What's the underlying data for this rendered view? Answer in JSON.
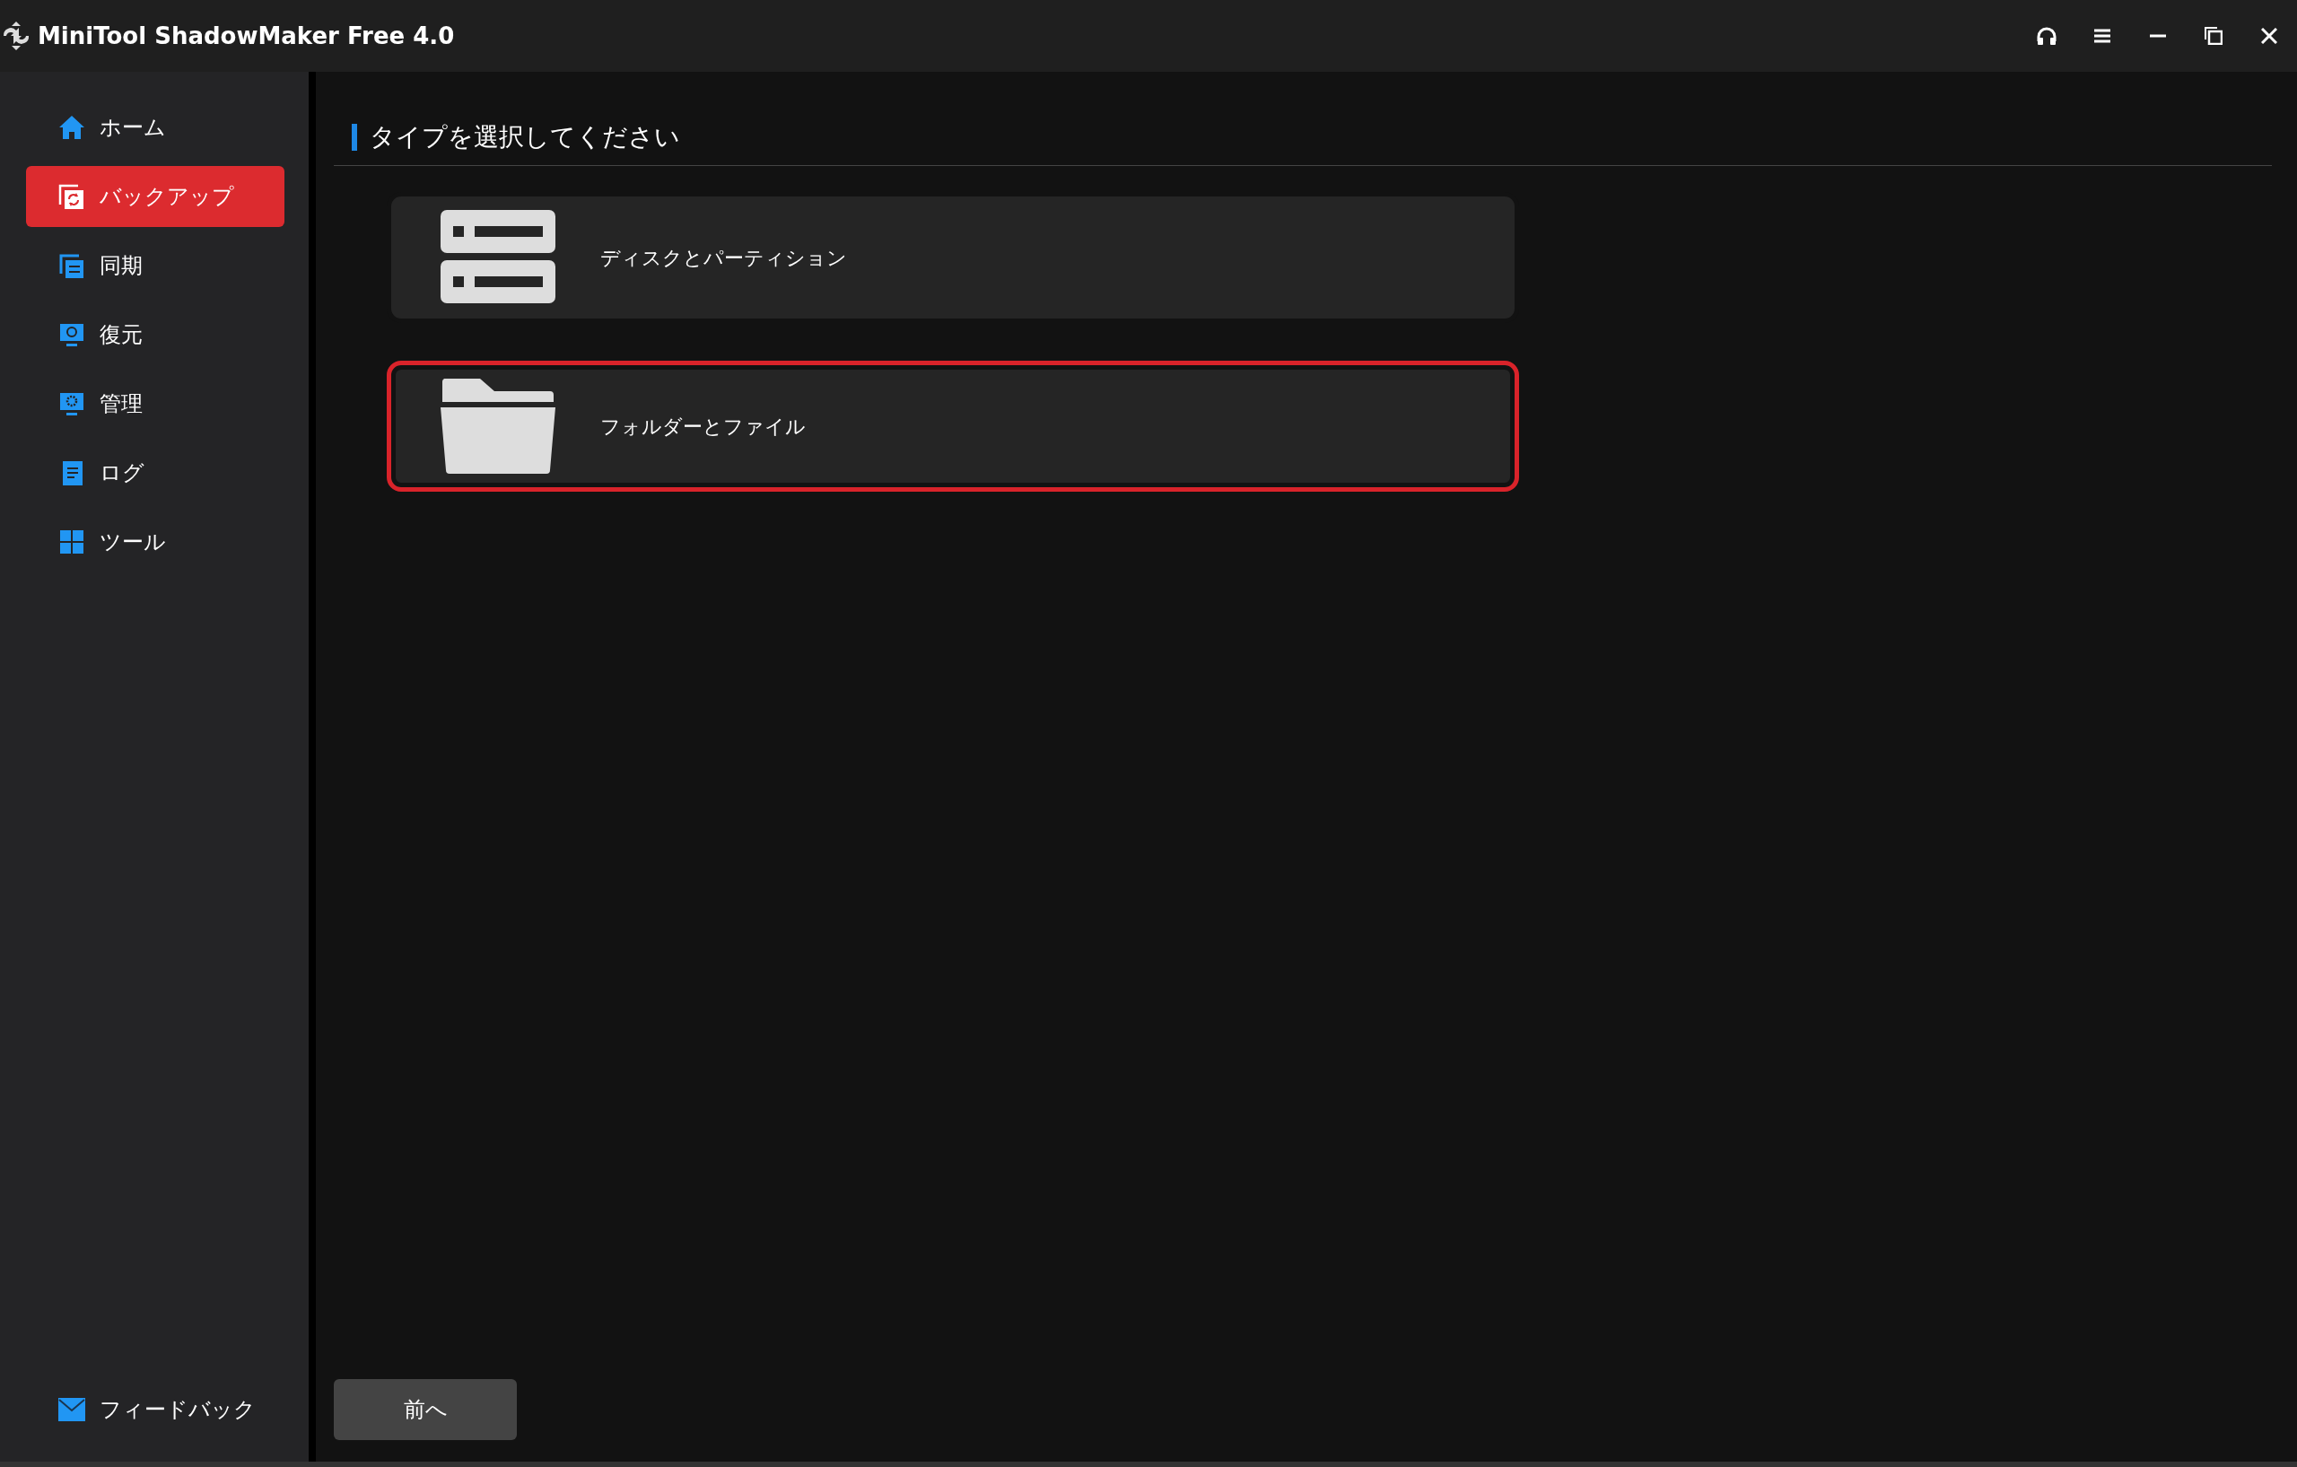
{
  "window": {
    "title": "MiniTool ShadowMaker Free 4.0"
  },
  "sidebar": {
    "items": [
      {
        "label": "ホーム",
        "selected": false
      },
      {
        "label": "バックアップ",
        "selected": true
      },
      {
        "label": "同期",
        "selected": false
      },
      {
        "label": "復元",
        "selected": false
      },
      {
        "label": "管理",
        "selected": false
      },
      {
        "label": "ログ",
        "selected": false
      },
      {
        "label": "ツール",
        "selected": false
      }
    ],
    "feedback": "フィードバック"
  },
  "content": {
    "heading": "タイプを選択してください",
    "options": [
      {
        "label": "ディスクとパーティション",
        "selected": false
      },
      {
        "label": "フォルダーとファイル",
        "selected": true
      }
    ],
    "back_button": "前へ"
  }
}
